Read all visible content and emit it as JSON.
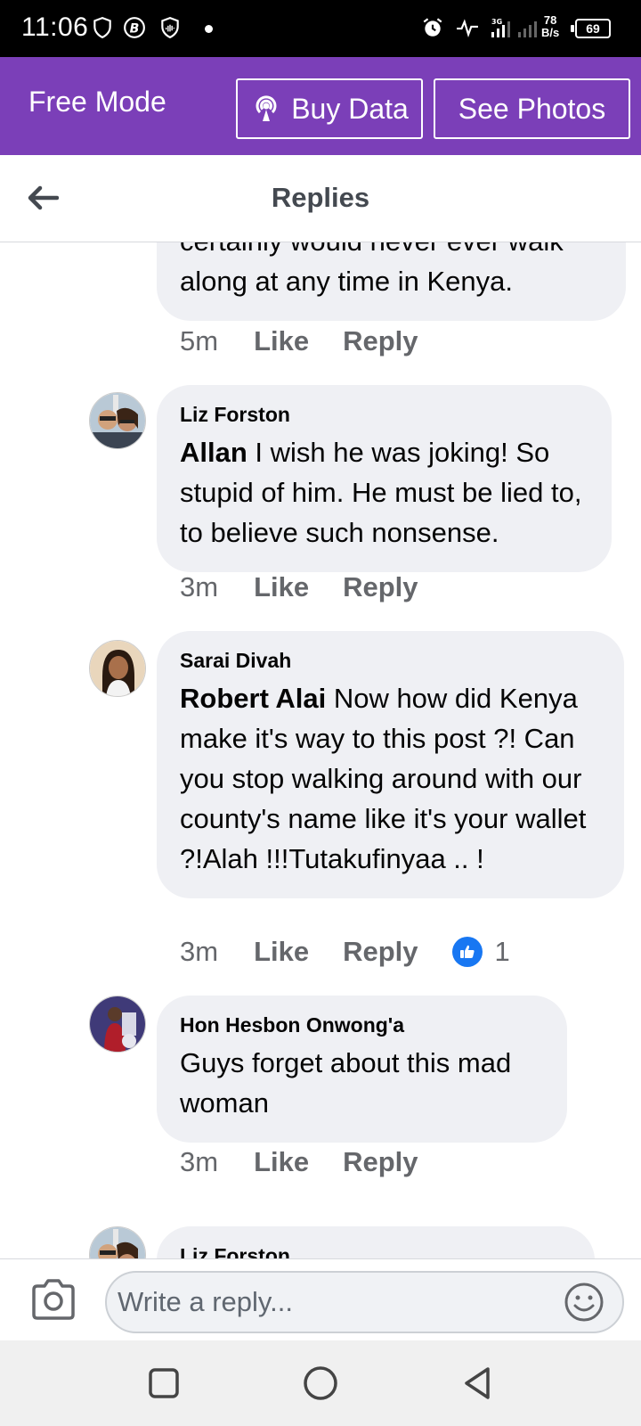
{
  "status_bar": {
    "time": "11:06",
    "net_speed_value": "78",
    "net_speed_unit": "B/s",
    "battery": "69",
    "icons": [
      "shield-icon",
      "b-badge-icon",
      "shield-wave-icon",
      "alarm-icon",
      "pulse-icon",
      "signal-3g-icon",
      "signal-icon"
    ]
  },
  "free_bar": {
    "label": "Free Mode",
    "buy_data_label": "Buy Data",
    "see_photos_label": "See Photos",
    "color": "#7b3fb8"
  },
  "header": {
    "title": "Replies",
    "back_icon": "arrow-left-icon"
  },
  "comments": [
    {
      "text": "certainly would never ever walk along at any time in Kenya.",
      "age": "5m",
      "like_label": "Like",
      "reply_label": "Reply"
    },
    {
      "author": "Liz Forston",
      "mention": "Allan",
      "text": " I wish he was joking!  So stupid of him.  He must be lied to, to believe such nonsense.",
      "age": "3m",
      "like_label": "Like",
      "reply_label": "Reply"
    },
    {
      "author": "Sarai Divah",
      "mention": "Robert Alai",
      "text": " Now how did Kenya make it's way to this post ?! Can you stop walking around with our county's name like it's your wallet ?!Alah !!!Tutakufinyaa .. !",
      "age": "3m",
      "like_label": "Like",
      "reply_label": "Reply",
      "reaction_count": "1"
    },
    {
      "author": "Hon Hesbon Onwong'a",
      "text": "Guys forget about this mad woman",
      "age": "3m",
      "like_label": "Like",
      "reply_label": "Reply"
    },
    {
      "author": "Liz Forston"
    }
  ],
  "composer": {
    "placeholder": "Write a reply...",
    "camera_icon": "camera-icon",
    "emoji_icon": "emoji-icon"
  },
  "nav_bar": {
    "icons": [
      "recents-icon",
      "home-icon",
      "back-icon"
    ]
  },
  "colors": {
    "bubble": "#eff0f4",
    "meta_text": "#65676b",
    "like_blue": "#1877f2"
  }
}
